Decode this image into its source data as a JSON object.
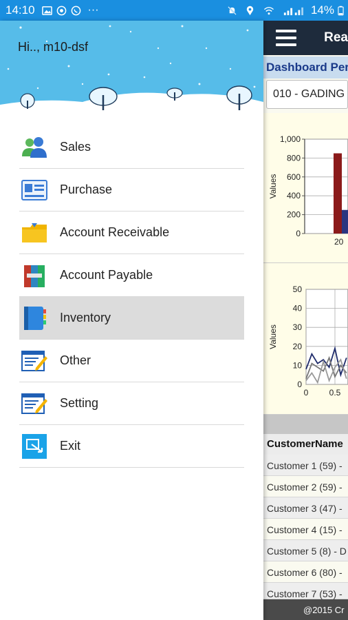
{
  "status_bar": {
    "time": "14:10",
    "battery": "14%",
    "left_icons": [
      "image-icon",
      "shield-icon",
      "whatsapp-icon",
      "more-dots-icon"
    ],
    "right_icons": [
      "mute-icon",
      "location-icon",
      "wifi-icon",
      "signal-icon",
      "battery-icon"
    ],
    "overflow": "···"
  },
  "drawer": {
    "greeting": "Hi.., m10-dsf",
    "header_bg": "#56bce9",
    "items": [
      {
        "label": "Sales",
        "icon": "users-icon"
      },
      {
        "label": "Purchase",
        "icon": "id-card-icon"
      },
      {
        "label": "Account Receivable",
        "icon": "folder-icon"
      },
      {
        "label": "Account Payable",
        "icon": "binders-icon"
      },
      {
        "label": "Inventory",
        "icon": "notebook-icon",
        "selected": true
      },
      {
        "label": "Other",
        "icon": "edit-form-icon"
      },
      {
        "label": "Setting",
        "icon": "edit-form-icon"
      },
      {
        "label": "Exit",
        "icon": "exit-icon"
      }
    ]
  },
  "background_app": {
    "title": "Rea",
    "subtitle": "Dashboard Per",
    "branch_select": "010 - GADING",
    "bar_chart": {
      "ylabel": "Values",
      "y_ticks": [
        "1,000",
        "800",
        "600",
        "400",
        "200",
        "0"
      ],
      "x_tick": "20"
    },
    "line_chart": {
      "ylabel": "Values",
      "y_ticks": [
        "50",
        "40",
        "30",
        "20",
        "10",
        "0"
      ],
      "x_ticks": [
        "0",
        "0.5"
      ]
    },
    "table": {
      "header": "CustomerName",
      "rows": [
        "Customer 1  (59) -",
        "Customer 2  (59) -",
        "Customer 3  (47) -",
        "Customer 4  (15) -",
        "Customer 5  (8) - D",
        "Customer 6  (80) -",
        "Customer 7  (53) -"
      ]
    },
    "footer": "@2015 Cr"
  },
  "chart_data": [
    {
      "type": "bar",
      "ylabel": "Values",
      "ylim": [
        0,
        1000
      ],
      "categories": [
        "20"
      ],
      "series": [
        {
          "values": [
            850
          ],
          "color": "#8b1a1a"
        },
        {
          "values": [
            250
          ],
          "color": "#2a3580"
        }
      ]
    },
    {
      "type": "line",
      "ylabel": "Values",
      "ylim": [
        0,
        50
      ],
      "x": [
        0,
        0.1,
        0.2,
        0.3,
        0.4,
        0.5,
        0.6,
        0.7
      ],
      "series": [
        {
          "values": [
            8,
            16,
            11,
            13,
            9,
            19,
            5,
            14
          ],
          "color": "#1e2b6b"
        },
        {
          "values": [
            3,
            11,
            9,
            7,
            14,
            4,
            10,
            6
          ],
          "color": "#777777"
        },
        {
          "values": [
            2,
            6,
            1,
            12,
            2,
            9,
            13,
            3
          ],
          "color": "#999999"
        }
      ]
    }
  ]
}
